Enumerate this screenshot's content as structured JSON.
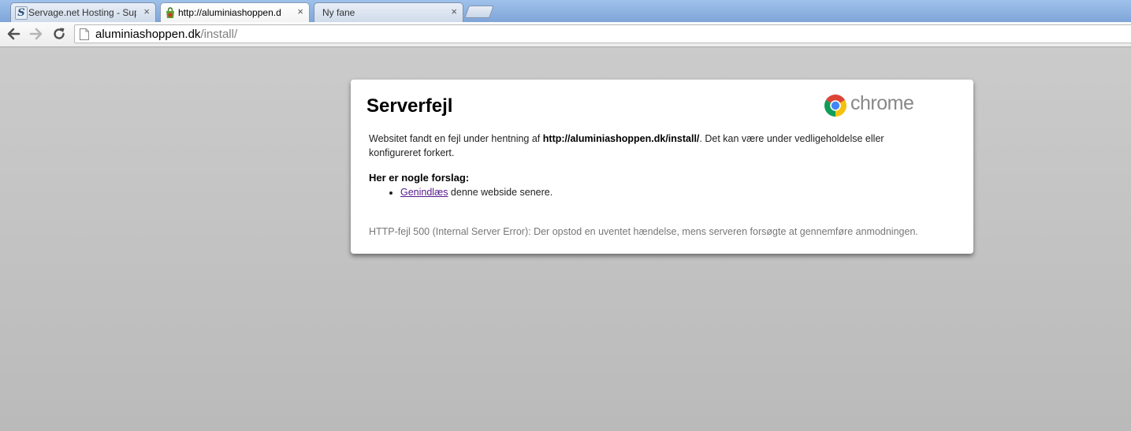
{
  "browser": {
    "tabs": [
      {
        "title": "Servage.net Hosting - Sup",
        "icon": "servage-s-icon",
        "active": false
      },
      {
        "title": "http://aluminiashoppen.d",
        "icon": "shop-bag-icon",
        "active": true
      },
      {
        "title": "Ny fane",
        "icon": "",
        "active": false
      }
    ],
    "close_glyph": "×",
    "url_host": "aluminiashoppen.dk",
    "url_path": "/install/"
  },
  "error_page": {
    "title": "Serverfejl",
    "brand": "chrome",
    "desc_before": "Websitet fandt en fejl under hentning af ",
    "desc_url": "http://aluminiashoppen.dk/install/",
    "desc_after": ". Det kan være under vedligeholdelse eller konfigureret forkert.",
    "suggestions_heading": "Her er nogle forslag:",
    "reload_link": "Genindlæs",
    "reload_rest": " denne webside senere.",
    "error_code": "HTTP-fejl 500 (Internal Server Error): Der opstod en uventet hændelse, mens serveren forsøgte at gennemføre anmodningen."
  },
  "colors": {
    "link_visited": "#551a8b",
    "tabstrip": "#8fb4e3",
    "page_background": "#c4c4c4"
  }
}
